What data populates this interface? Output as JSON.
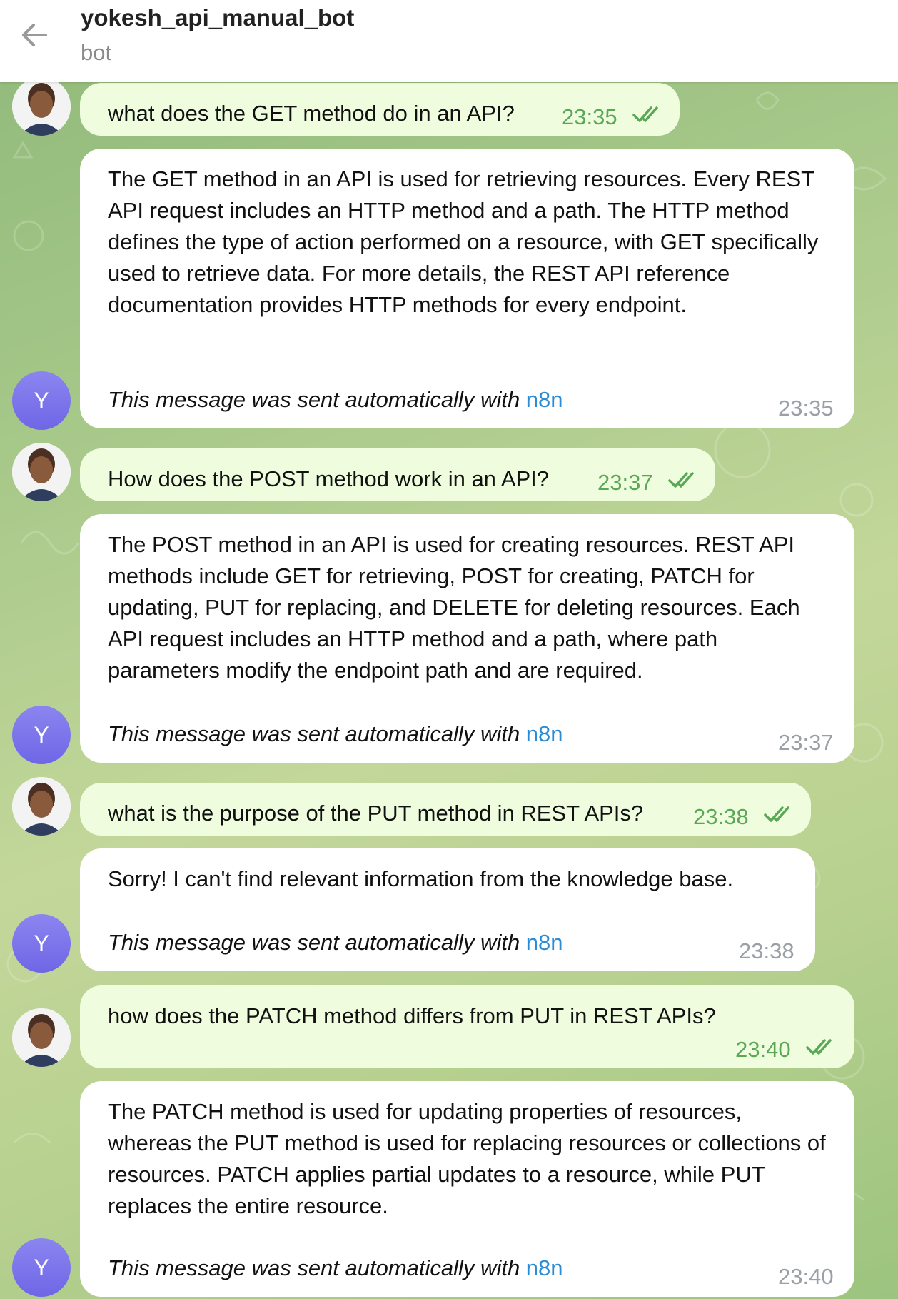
{
  "header": {
    "title": "yokesh_api_manual_bot",
    "subtitle": "bot"
  },
  "colors": {
    "outgoing_bubble": "#effdde",
    "incoming_bubble": "#ffffff",
    "timestamp_green": "#5aa856",
    "link_blue": "#2a8bd6",
    "bot_avatar": "#7b73ec"
  },
  "bot_avatar_letter": "Y",
  "auto_note": {
    "prefix": "This message was sent automatically with ",
    "link": "n8n"
  },
  "messages": [
    {
      "text": "what does the GET method do in an API?",
      "time": "23:35"
    },
    {
      "text": "The GET method in an API is used for retrieving resources. Every REST API request includes an HTTP method and a path. The HTTP method defines the type of action performed on a resource, with GET specifically used to retrieve data. For more details, the REST API reference documentation provides HTTP methods for every endpoint.",
      "time": "23:35"
    },
    {
      "text": "How does the POST method work in an API?",
      "time": "23:37"
    },
    {
      "text": "The POST method in an API is used for creating resources. REST API methods include GET for retrieving, POST for creating, PATCH for updating, PUT for replacing, and DELETE for deleting resources. Each API request includes an HTTP method and a path, where path parameters modify the endpoint path and are required.",
      "time": "23:37"
    },
    {
      "text": "what is the purpose of the PUT method in REST APIs?",
      "time": "23:38"
    },
    {
      "text": "Sorry! I can't find relevant information from the knowledge base.",
      "time": "23:38"
    },
    {
      "text": "how does the PATCH method differs from PUT in REST APIs?",
      "time": "23:40"
    },
    {
      "text": "The PATCH method is used for updating properties of resources, whereas the PUT method is used for replacing resources or collections of resources. PATCH applies partial updates to a resource, while PUT replaces the entire resource.",
      "time": "23:40"
    }
  ]
}
